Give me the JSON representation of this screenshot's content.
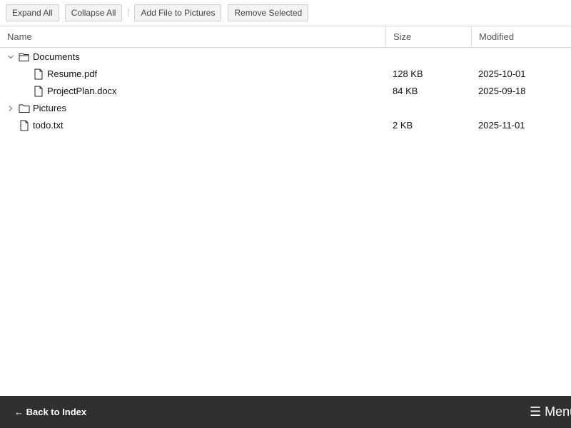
{
  "toolbar": {
    "expand_all": "Expand All",
    "collapse_all": "Collapse All",
    "add_file": "Add File to Pictures",
    "remove_selected": "Remove Selected"
  },
  "columns": {
    "name": "Name",
    "size": "Size",
    "modified": "Modified"
  },
  "tree": [
    {
      "name": "Documents",
      "type": "folder",
      "expanded": true,
      "size": "",
      "modified": ""
    },
    {
      "name": "Resume.pdf",
      "type": "file",
      "parent": "Documents",
      "size": "128 KB",
      "modified": "2025-10-01"
    },
    {
      "name": "ProjectPlan.docx",
      "type": "file",
      "parent": "Documents",
      "size": "84 KB",
      "modified": "2025-09-18"
    },
    {
      "name": "Pictures",
      "type": "folder",
      "expanded": false,
      "size": "",
      "modified": ""
    },
    {
      "name": "todo.txt",
      "type": "file",
      "size": "2 KB",
      "modified": "2025-11-01"
    }
  ],
  "footer": {
    "back_label": "← Back to Index",
    "menu_label": "☰ Menu"
  }
}
